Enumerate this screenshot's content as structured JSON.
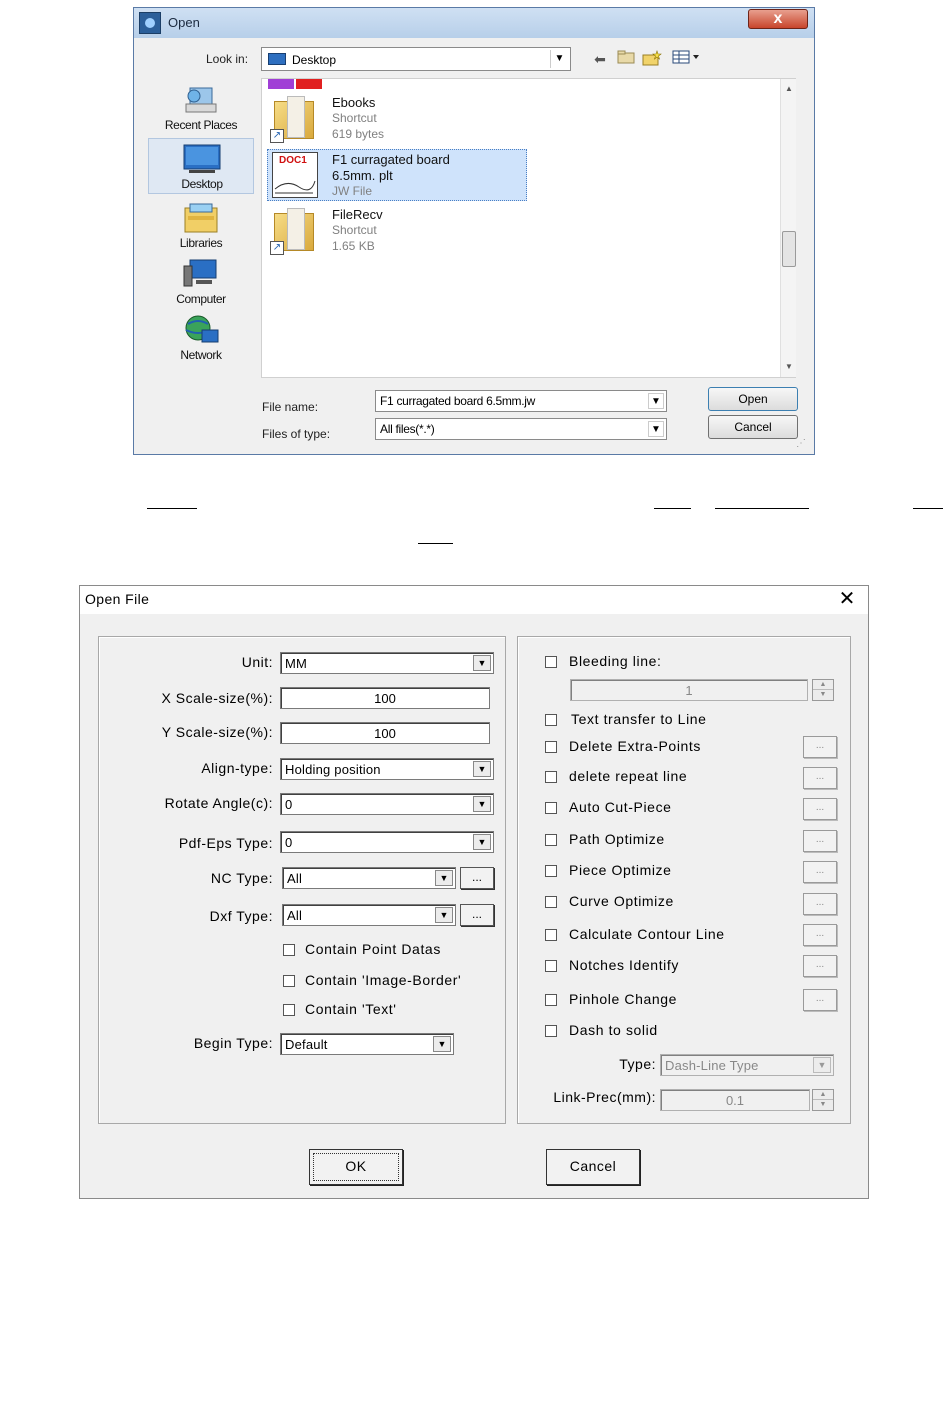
{
  "open_dialog": {
    "title": "Open",
    "close_glyph": "x",
    "look_in_label": "Look in:",
    "look_in_value": "Desktop",
    "toolbar_icons": [
      "back-icon",
      "up-folder-icon",
      "new-folder-icon",
      "view-menu-icon"
    ],
    "places": [
      {
        "label": "Recent Places",
        "icon": "recent-places-icon"
      },
      {
        "label": "Desktop",
        "icon": "desktop-icon"
      },
      {
        "label": "Libraries",
        "icon": "libraries-icon"
      },
      {
        "label": "Computer",
        "icon": "computer-icon"
      },
      {
        "label": "Network",
        "icon": "network-icon"
      }
    ],
    "files": [
      {
        "name": "Ebooks",
        "line2": "Shortcut",
        "line3": "619 bytes",
        "selected": false
      },
      {
        "name": "F1 curragated board",
        "line2": "6.5mm. plt",
        "line3": "JW File",
        "tag": "DOC1",
        "selected": true
      },
      {
        "name": "FileRecv",
        "line2": "Shortcut",
        "line3": "1.65 KB",
        "selected": false
      }
    ],
    "file_name_label": "File name:",
    "file_name_value": "F1 curragated board 6.5mm.jw",
    "files_of_type_label": "Files of type:",
    "files_of_type_value": "All files(*.*)",
    "open_button": "Open",
    "cancel_button": "Cancel"
  },
  "open_file": {
    "title": "Open File",
    "close_glyph": "✕",
    "left": {
      "unit_label": "Unit:",
      "unit_value": "MM",
      "x_scale_label": "X Scale-size(%):",
      "x_scale_value": "100",
      "y_scale_label": "Y Scale-size(%):",
      "y_scale_value": "100",
      "align_label": "Align-type:",
      "align_value": "Holding position",
      "rotate_label": "Rotate Angle(c):",
      "rotate_value": "0",
      "pdf_eps_label": "Pdf-Eps Type:",
      "pdf_eps_value": "0",
      "nc_label": "NC Type:",
      "nc_value": "All",
      "dxf_label": "Dxf Type:",
      "dxf_value": "All",
      "ellipsis": "...",
      "contain_point": "Contain Point Datas",
      "contain_image_border": "Contain 'Image-Border'",
      "contain_text": "Contain 'Text'",
      "begin_label": "Begin Type:",
      "begin_value": "Default"
    },
    "right": {
      "bleeding_line": "Bleeding line:",
      "bleeding_value": "1",
      "text_to_line": "Text transfer to Line",
      "delete_extra_points": "Delete Extra-Points",
      "delete_repeat_line": "delete repeat line",
      "auto_cut_piece": "Auto Cut-Piece",
      "path_optimize": "Path Optimize",
      "piece_optimize": "Piece Optimize",
      "curve_optimize": "Curve Optimize",
      "calc_contour": "Calculate Contour Line",
      "notches_identify": "Notches Identify",
      "pinhole_change": "Pinhole Change",
      "dash_to_solid": "Dash to solid",
      "type_label": "Type:",
      "type_value": "Dash-Line Type",
      "link_prec_label": "Link-Prec(mm):",
      "link_prec_value": "0.1",
      "ellipsis": "..."
    },
    "ok_button": "OK",
    "cancel_button": "Cancel"
  }
}
